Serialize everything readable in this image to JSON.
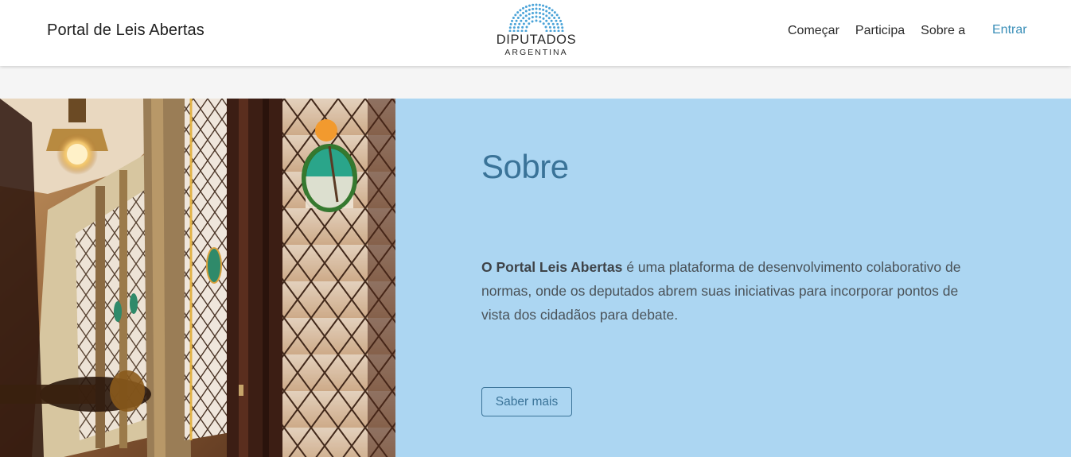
{
  "header": {
    "site_title": "Portal de Leis Abertas",
    "logo": {
      "main": "DIPUTADOS",
      "sub": "ARGENTINA",
      "color": "#4aa3d8"
    },
    "nav": [
      {
        "label": "Começar"
      },
      {
        "label": "Participa"
      },
      {
        "label": "Sobre a"
      }
    ],
    "login_label": "Entrar"
  },
  "hero": {
    "title": "Sobre",
    "text_bold": "O Portal Leis Abertas",
    "text_rest": " é uma plataforma de desenvolvimento colaborativo de normas, onde os deputados abrem suas iniciativas para incorporar pontos de vista dos cidadãos para debate.",
    "button_label": "Saber mais",
    "panel_color": "#acd6f2",
    "accent_color": "#3a7398"
  }
}
